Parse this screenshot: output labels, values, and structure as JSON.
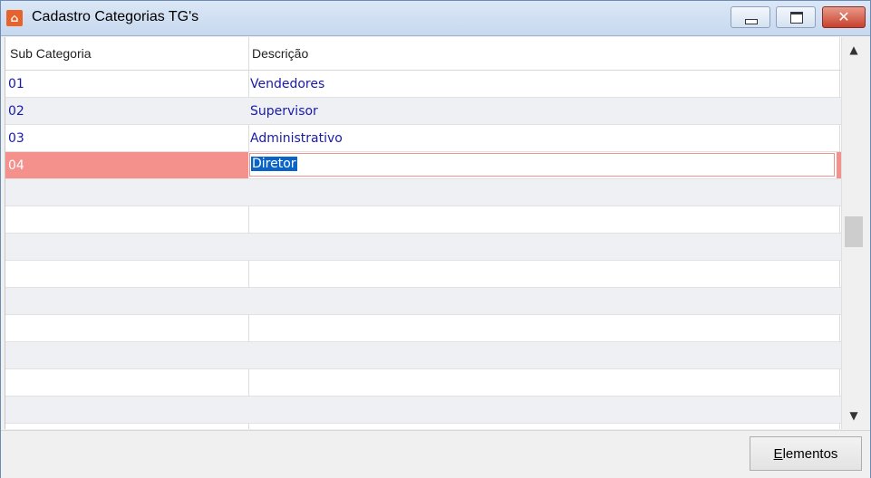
{
  "window": {
    "title": "Cadastro Categorias TG's",
    "app_icon": "app-logo-icon",
    "controls": {
      "minimize": "minimize-icon",
      "maximize": "restore-icon",
      "close": "✕"
    }
  },
  "grid": {
    "columns": [
      "Sub Categoria",
      "Descrição"
    ],
    "rows": [
      {
        "code": "01",
        "description": "Vendedores"
      },
      {
        "code": "02",
        "description": "Supervisor"
      },
      {
        "code": "03",
        "description": "Administrativo"
      },
      {
        "code": "04",
        "description": "Diretor"
      }
    ],
    "selected_row_index": 3,
    "empty_rows": 9
  },
  "colors": {
    "selected_row": "#f4918d",
    "text_blue": "#1a1aa8",
    "selection_highlight": "#0a64c8"
  },
  "scrollbar": {
    "up": "▲",
    "down": "▼"
  },
  "footer": {
    "elementos_button_label": "Elementos",
    "elementos_mnemonic": "E",
    "elementos_rest": "lementos"
  }
}
